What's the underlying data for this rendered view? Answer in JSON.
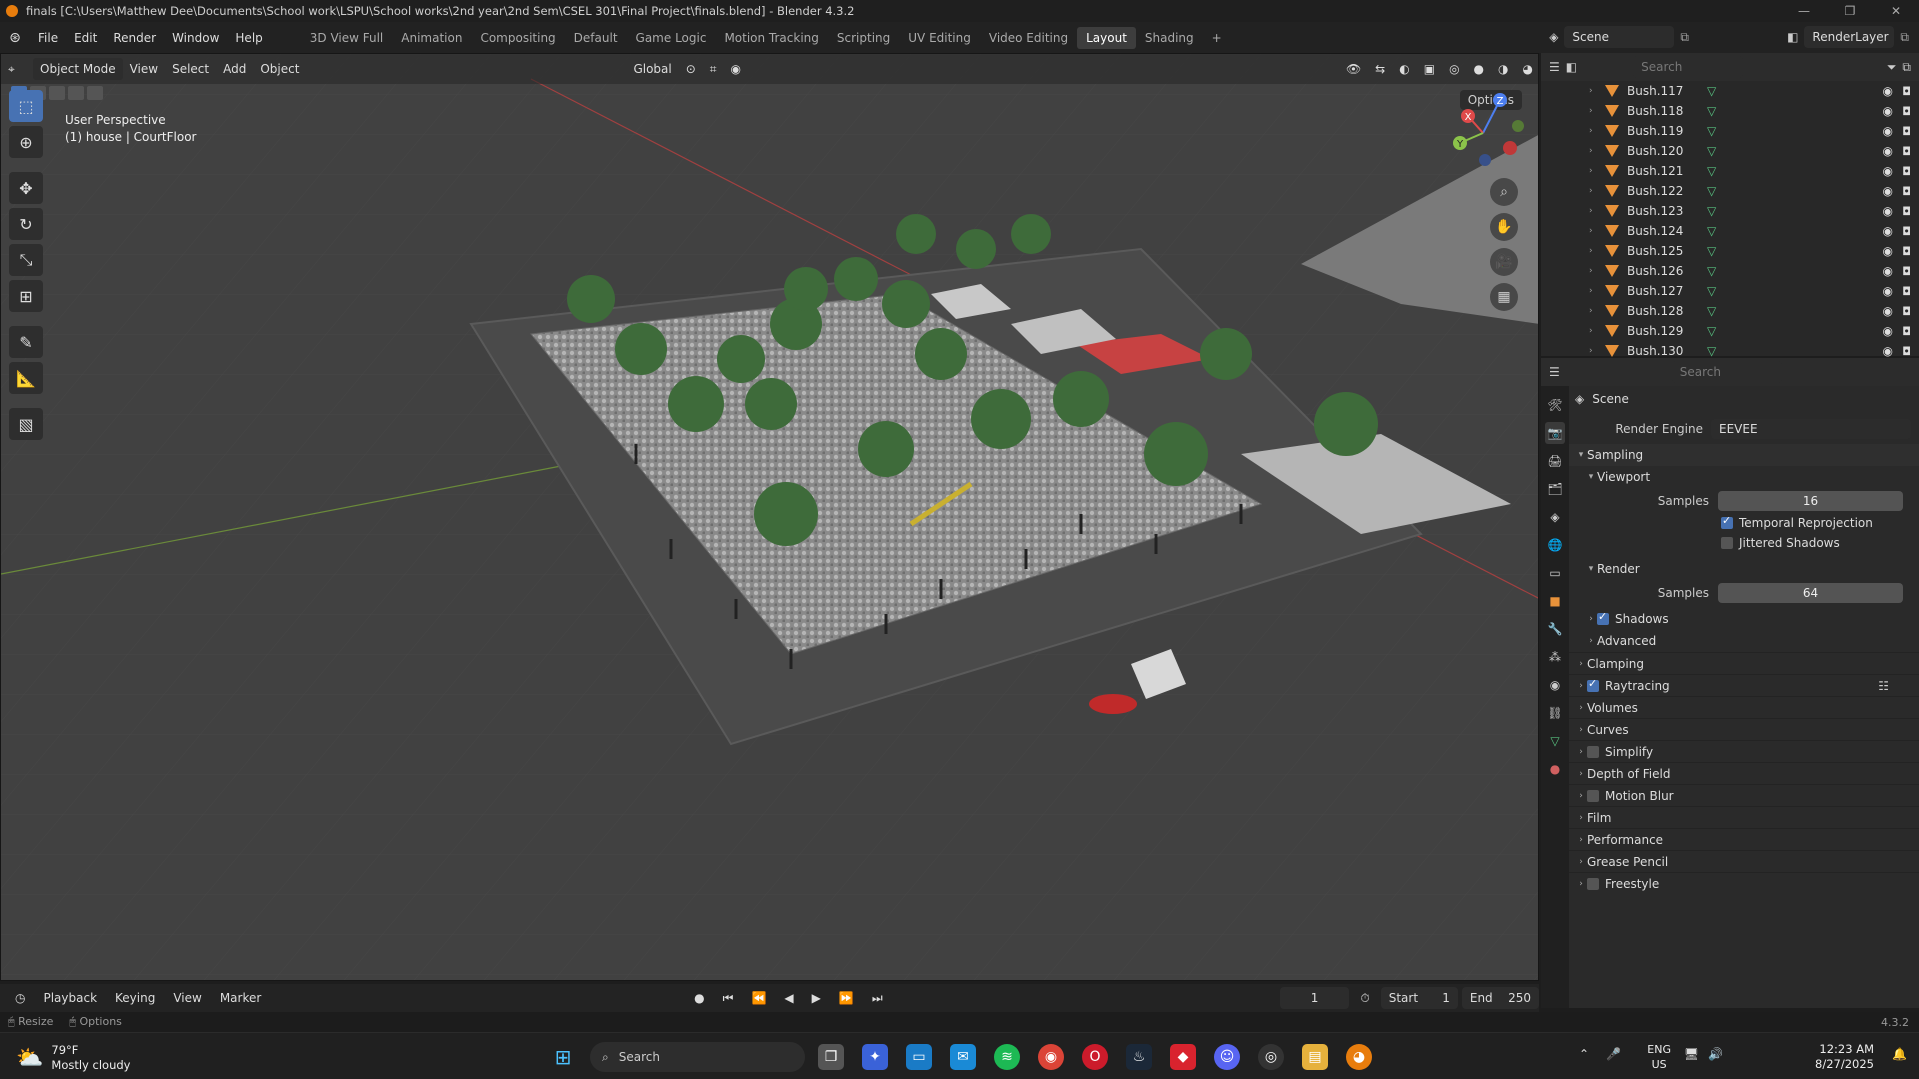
{
  "window": {
    "title": "finals [C:\\Users\\Matthew Dee\\Documents\\School work\\LSPU\\School works\\2nd year\\2nd Sem\\CSEL 301\\Final Project\\finals.blend] - Blender 4.3.2"
  },
  "menus": [
    "File",
    "Edit",
    "Render",
    "Window",
    "Help"
  ],
  "workspaces": [
    {
      "label": "3D View Full",
      "active": false
    },
    {
      "label": "Animation",
      "active": false
    },
    {
      "label": "Compositing",
      "active": false
    },
    {
      "label": "Default",
      "active": false
    },
    {
      "label": "Game Logic",
      "active": false
    },
    {
      "label": "Motion Tracking",
      "active": false
    },
    {
      "label": "Scripting",
      "active": false
    },
    {
      "label": "UV Editing",
      "active": false
    },
    {
      "label": "Video Editing",
      "active": false
    },
    {
      "label": "Layout",
      "active": true
    },
    {
      "label": "Shading",
      "active": false
    }
  ],
  "add_workspace": "+",
  "scene": {
    "name": "Scene",
    "render_layer": "RenderLayer"
  },
  "viewport": {
    "mode": "Object Mode",
    "menu": [
      "View",
      "Select",
      "Add",
      "Object"
    ],
    "transform_orientation": "Global",
    "options_label": "Options",
    "info_line1": "User Perspective",
    "info_line2": "(1) house | CourtFloor",
    "gizmo_axes": [
      "Z",
      "X",
      "Y"
    ]
  },
  "outliner": {
    "search_placeholder": "Search",
    "items": [
      "Bush.117",
      "Bush.118",
      "Bush.119",
      "Bush.120",
      "Bush.121",
      "Bush.122",
      "Bush.123",
      "Bush.124",
      "Bush.125",
      "Bush.126",
      "Bush.127",
      "Bush.128",
      "Bush.129",
      "Bush.130"
    ]
  },
  "properties": {
    "search_placeholder": "Search",
    "context": "Scene",
    "render_engine_label": "Render Engine",
    "render_engine_value": "EEVEE",
    "sampling": "Sampling",
    "viewport": "Viewport",
    "viewport_samples_label": "Samples",
    "viewport_samples": "16",
    "temporal_reprojection": "Temporal Reprojection",
    "jittered_shadows": "Jittered Shadows",
    "render": "Render",
    "render_samples_label": "Samples",
    "render_samples": "64",
    "shadows": "Shadows",
    "advanced": "Advanced",
    "clamping": "Clamping",
    "raytracing": "Raytracing",
    "volumes": "Volumes",
    "curves": "Curves",
    "simplify": "Simplify",
    "depth_of_field": "Depth of Field",
    "motion_blur": "Motion Blur",
    "film": "Film",
    "performance": "Performance",
    "grease_pencil": "Grease Pencil",
    "freestyle": "Freestyle"
  },
  "timeline": {
    "menus": [
      "Playback",
      "Keying",
      "View",
      "Marker"
    ],
    "current_frame": "1",
    "start_label": "Start",
    "start": "1",
    "end_label": "End",
    "end": "250"
  },
  "statusbar": {
    "resize": "Resize",
    "options": "Options",
    "version": "4.3.2"
  },
  "taskbar": {
    "temperature": "79°F",
    "weather": "Mostly cloudy",
    "search": "Search",
    "lang1": "ENG",
    "lang2": "US",
    "time": "12:23 AM",
    "date": "8/27/2025"
  }
}
